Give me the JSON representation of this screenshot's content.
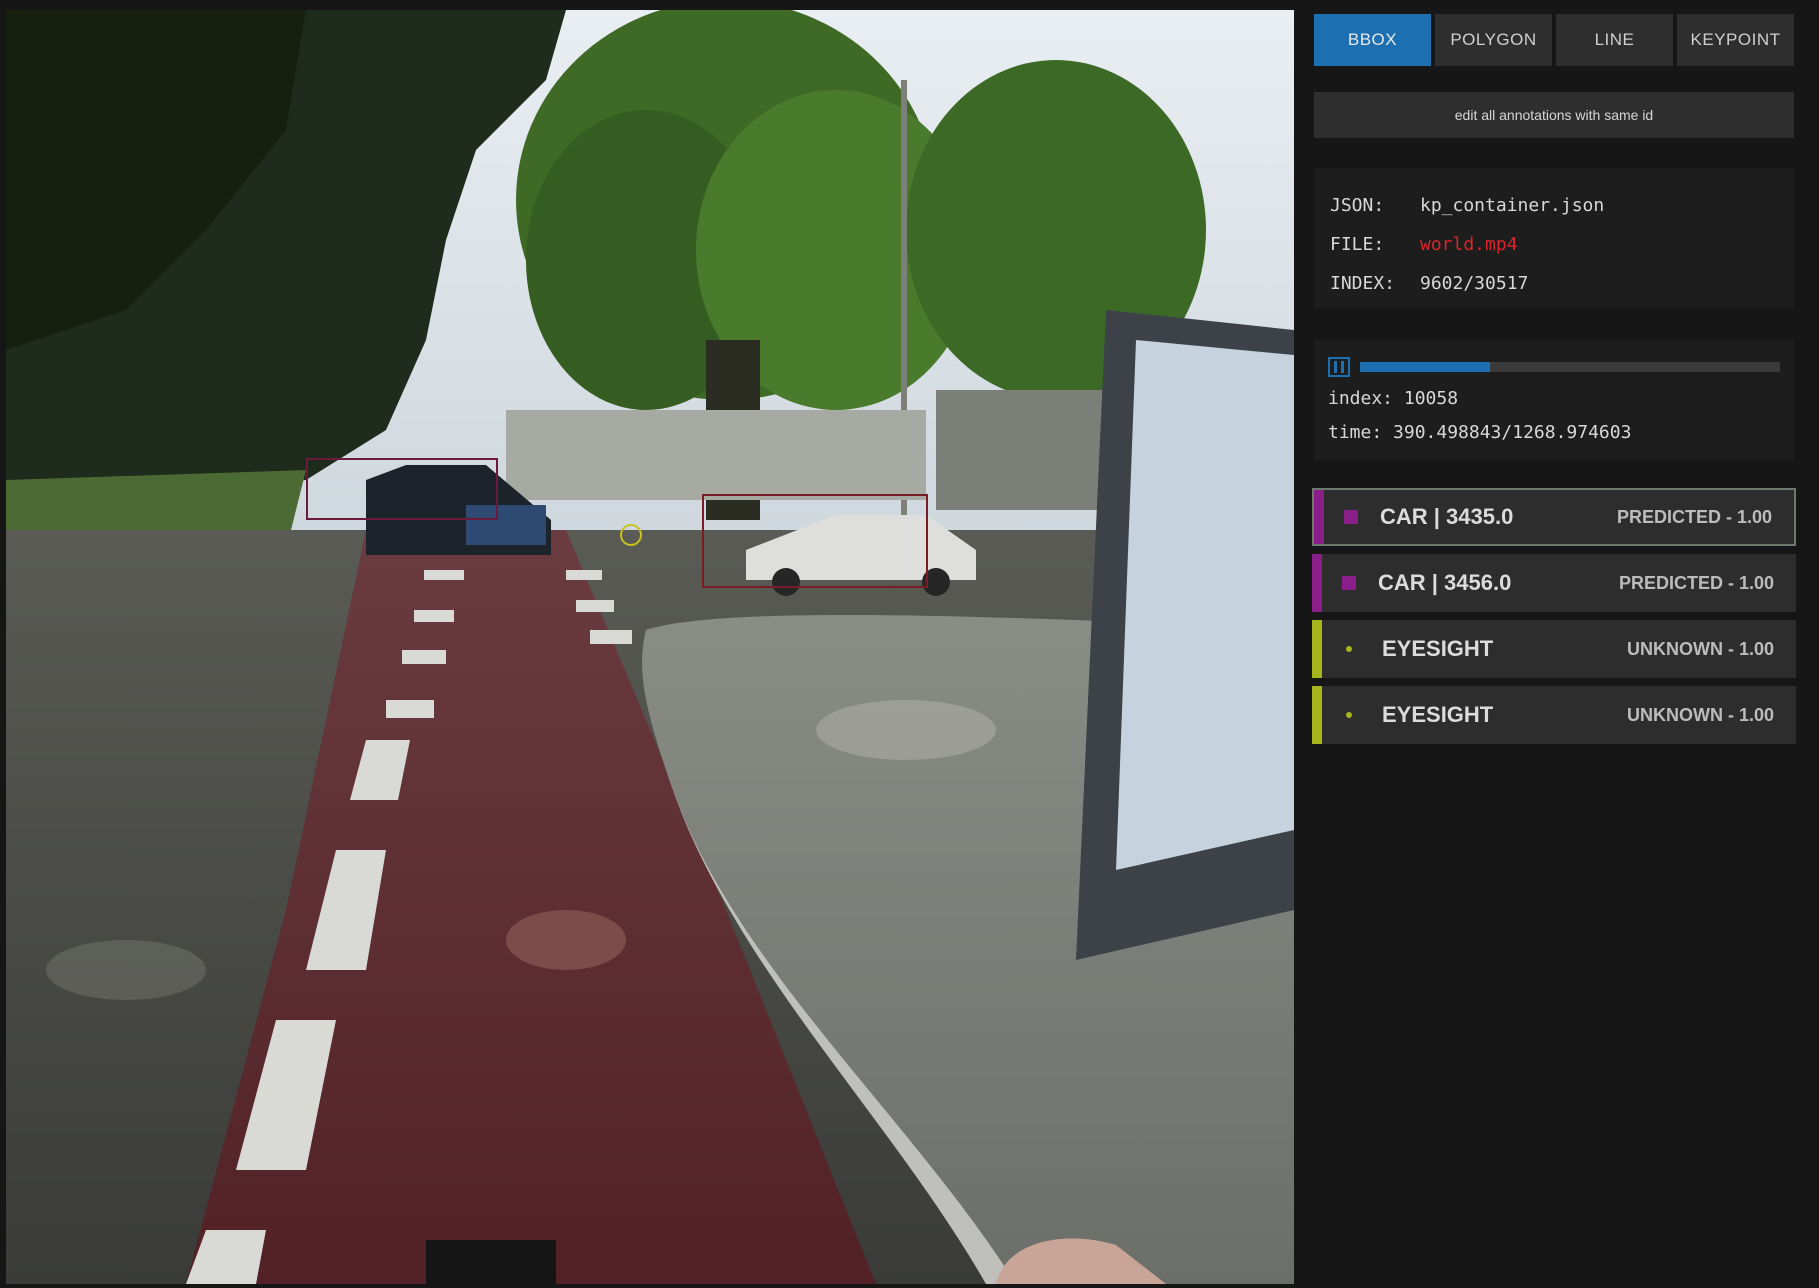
{
  "mode_tabs": [
    {
      "label": "bbox",
      "active": true
    },
    {
      "label": "POLYGON",
      "active": false
    },
    {
      "label": "LINE",
      "active": false
    },
    {
      "label": "KEYPOINT",
      "active": false
    }
  ],
  "edit_all_label": "edit all annotations with same id",
  "file_info": {
    "json_key": "JSON:",
    "json_value": "kp_container.json",
    "file_key": "FILE:",
    "file_value": "world.mp4",
    "index_key": "INDEX:",
    "index_value": "9602/30517"
  },
  "playback": {
    "progress_fraction": 0.31,
    "index_text": "index: 10058",
    "time_text": "time: 390.498843/1268.974603"
  },
  "annotations": [
    {
      "title": "CAR | 3435.0",
      "status": "PREDICTED - 1.00",
      "color": "#8a1f8a",
      "selected": true,
      "kind": "bbox"
    },
    {
      "title": "CAR | 3456.0",
      "status": "PREDICTED - 1.00",
      "color": "#8a1f8a",
      "selected": false,
      "kind": "bbox"
    },
    {
      "title": "EYESIGHT",
      "status": "UNKNOWN - 1.00",
      "color": "#a6b51c",
      "selected": false,
      "kind": "keypoint"
    },
    {
      "title": "EYESIGHT",
      "status": "UNKNOWN - 1.00",
      "color": "#a6b51c",
      "selected": false,
      "kind": "keypoint"
    }
  ],
  "colors": {
    "accent": "#1c6fb0",
    "file_name": "#d8262c",
    "car_class": "#8a1f8a",
    "eyesight_class": "#a6b51c",
    "bbox_outline": "#7a1c26"
  }
}
